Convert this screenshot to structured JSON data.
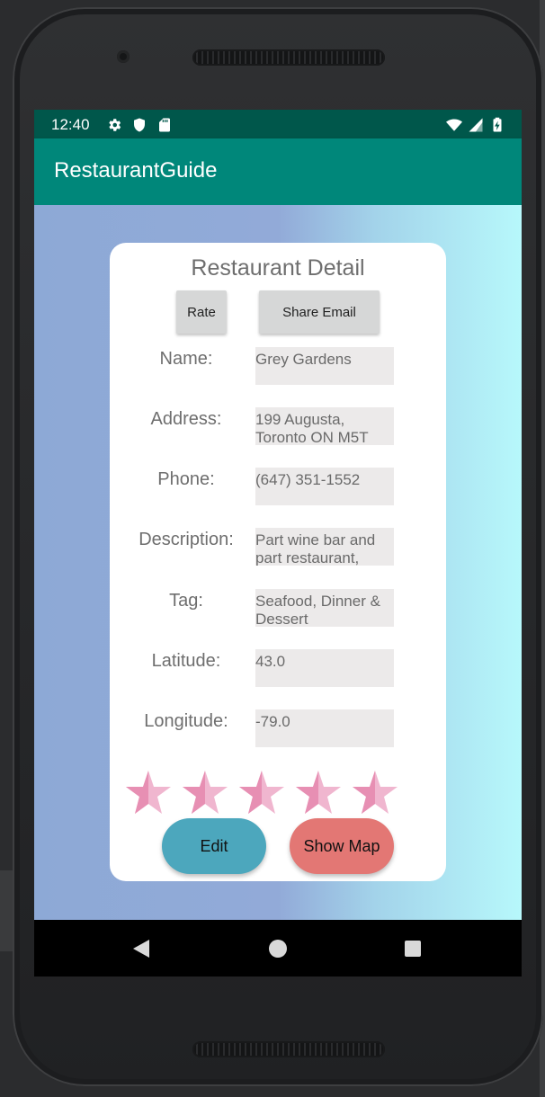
{
  "status_bar": {
    "time": "12:40",
    "left_icons": [
      "settings-icon",
      "shield-icon",
      "sd-card-icon"
    ],
    "right_icons": [
      "wifi-icon",
      "signal-icon",
      "battery-charging-icon"
    ]
  },
  "app_bar": {
    "title": "RestaurantGuide"
  },
  "card": {
    "title": "Restaurant Detail",
    "rate_label": "Rate",
    "share_label": "Share Email",
    "fields": [
      {
        "label": "Name:",
        "value": "Grey Gardens"
      },
      {
        "label": "Address:",
        "value": "199 Augusta, Toronto ON M5T"
      },
      {
        "label": "Phone:",
        "value": "(647) 351-1552"
      },
      {
        "label": "Description:",
        "value": "Part wine bar and part restaurant,"
      },
      {
        "label": "Tag:",
        "value": "Seafood, Dinner & Dessert"
      },
      {
        "label": "Latitude:",
        "value": "43.0"
      },
      {
        "label": "Longitude:",
        "value": "-79.0"
      }
    ],
    "rating": {
      "stars_total": 5,
      "star_color": "#e78fb3"
    },
    "edit_label": "Edit",
    "map_label": "Show Map"
  },
  "colors": {
    "status_bar": "#00574b",
    "app_bar": "#00877a",
    "edit_button": "#4ca7bd",
    "map_button": "#e37774"
  },
  "nav_bar": {
    "icons": [
      "back-icon",
      "home-icon",
      "recent-apps-icon"
    ]
  }
}
